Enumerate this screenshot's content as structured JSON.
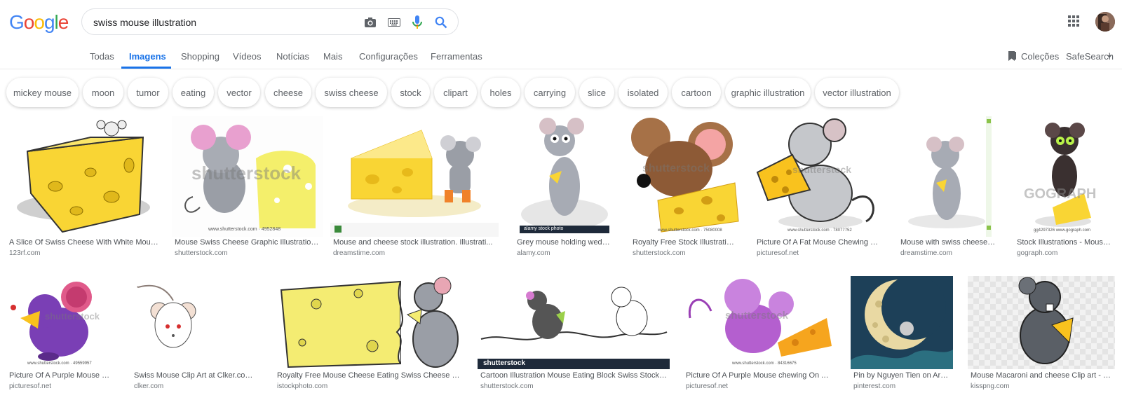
{
  "logo": {
    "letters": [
      "G",
      "o",
      "o",
      "g",
      "l",
      "e"
    ]
  },
  "search": {
    "value": "swiss mouse illustration"
  },
  "icons": {
    "camera": "camera-icon",
    "keyboard": "keyboard-icon",
    "mic": "microphone-icon",
    "search": "search-icon",
    "apps": "apps-grid-icon"
  },
  "tabs": [
    "Todas",
    "Imagens",
    "Shopping",
    "Vídeos",
    "Notícias",
    "Mais",
    "Configurações",
    "Ferramentas"
  ],
  "right_tools": {
    "collections": "Coleções",
    "safesearch": "SafeSearch"
  },
  "chips": [
    "mickey mouse",
    "moon",
    "tumor",
    "eating",
    "vector",
    "cheese",
    "swiss cheese",
    "stock",
    "clipart",
    "holes",
    "carrying",
    "slice",
    "isolated",
    "cartoon",
    "graphic illustration",
    "vector illustration"
  ],
  "row1": [
    {
      "caption": "A Slice Of Swiss Cheese With White Mous...",
      "source": "123rf.com"
    },
    {
      "caption": "Mouse Swiss Cheese Graphic Illustration...",
      "source": "shutterstock.com",
      "watermark": "shutterstock",
      "footer": "www.shutterstock.com · 4952848"
    },
    {
      "caption": "Mouse and cheese stock illustration. Illustrati...",
      "source": "dreamstime.com"
    },
    {
      "caption": "Grey mouse holding wedg...",
      "source": "alamy.com",
      "footer": "alamy stock photo"
    },
    {
      "caption": "Royalty Free Stock Illustratio...",
      "source": "shutterstock.com",
      "watermark": "shutterstock",
      "footer": "www.shutterstock.com · 75080008"
    },
    {
      "caption": "Picture Of A Fat Mouse Chewing O...",
      "source": "picturesof.net",
      "watermark": "shutterstock",
      "footer": "www.shutterstock.com · 78077752"
    },
    {
      "caption": "Mouse with swiss cheese s...",
      "source": "dreamstime.com"
    },
    {
      "caption": "Stock Illustrations - Mouse ...",
      "source": "gograph.com",
      "watermark": "GOGRAPH",
      "footer": "gg4297326 www.gograph.com"
    }
  ],
  "row2": [
    {
      "caption": "Picture Of A Purple Mouse Ea...",
      "source": "picturesof.net",
      "watermark": "shutterstock",
      "footer": "www.shutterstock.com · 49559957"
    },
    {
      "caption": "Swiss Mouse Clip Art at Clker.com ...",
      "source": "clker.com"
    },
    {
      "caption": "Royalty Free Mouse Cheese Eating Swiss Cheese Cli...",
      "source": "istockphoto.com"
    },
    {
      "caption": "Cartoon Illustration Mouse Eating Block Swiss Stock ...",
      "source": "shutterstock.com",
      "footer": "shutterstock"
    },
    {
      "caption": "Picture Of A Purple Mouse chewing On A ...",
      "source": "picturesof.net",
      "watermark": "shutterstock",
      "footer": "www.shutterstock.com · 84316675"
    },
    {
      "caption": "Pin by Nguyen Tien on Art | ...",
      "source": "pinterest.com"
    },
    {
      "caption": "Mouse Macaroni and cheese Clip art - S...",
      "source": "kisspng.com"
    }
  ],
  "colors": {
    "accent": "#1a73e8",
    "cheese": "#f9d534",
    "mouse_grey": "#9a9ea6"
  }
}
